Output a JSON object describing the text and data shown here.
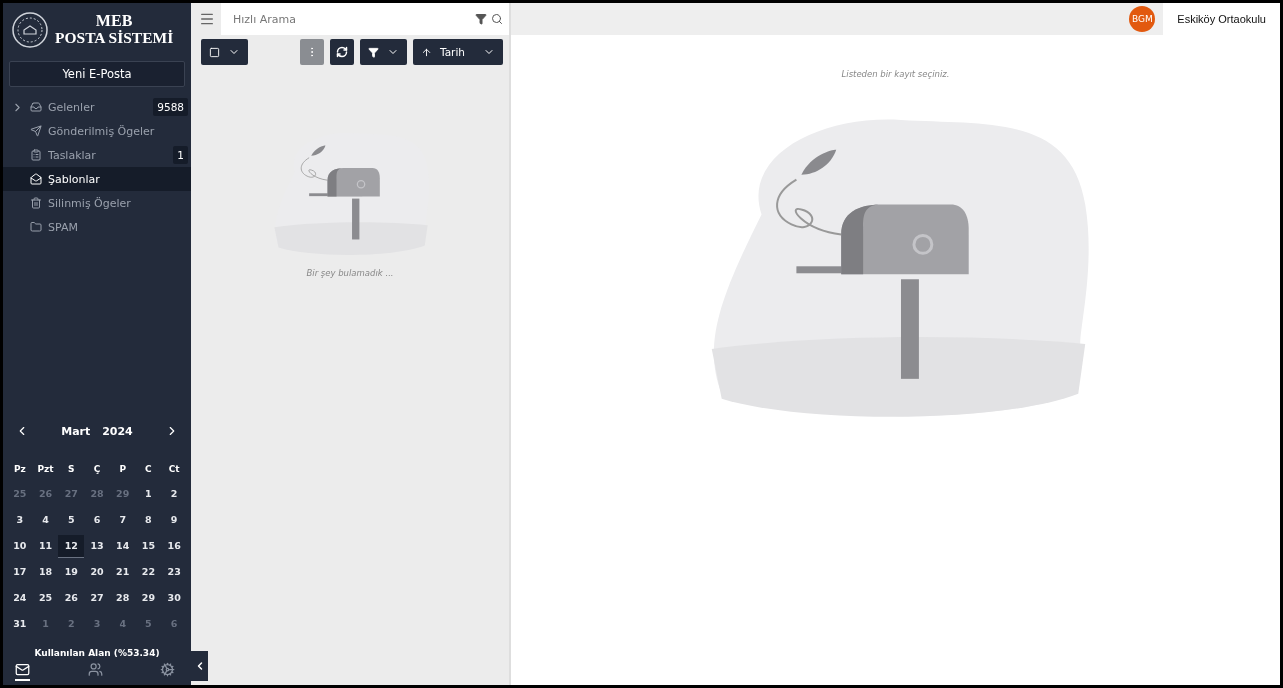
{
  "logo": {
    "line1": "MEB",
    "line2": "POSTA SİSTEMİ"
  },
  "new_mail_button": "Yeni E-Posta",
  "folders": [
    {
      "label": "Gelenler",
      "count": "9588",
      "expandable": true,
      "selected": false
    },
    {
      "label": "Gönderilmiş Ögeler",
      "expandable": false,
      "selected": false
    },
    {
      "label": "Taslaklar",
      "count": "1",
      "expandable": false,
      "selected": false
    },
    {
      "label": "Şablonlar",
      "expandable": false,
      "selected": true
    },
    {
      "label": "Silinmiş Ögeler",
      "expandable": false,
      "selected": false
    },
    {
      "label": "SPAM",
      "expandable": false,
      "selected": false
    }
  ],
  "calendar": {
    "month": "Mart",
    "year": "2024",
    "weekdays": [
      "Pz",
      "Pzt",
      "S",
      "Ç",
      "P",
      "C",
      "Ct"
    ],
    "weeks": [
      [
        {
          "day": "25",
          "muted": true,
          "selected": false
        },
        {
          "day": "26",
          "muted": true,
          "selected": false
        },
        {
          "day": "27",
          "muted": true,
          "selected": false
        },
        {
          "day": "28",
          "muted": true,
          "selected": false
        },
        {
          "day": "29",
          "muted": true,
          "selected": false
        },
        {
          "day": "1",
          "muted": false,
          "selected": false
        },
        {
          "day": "2",
          "muted": false,
          "selected": false
        }
      ],
      [
        {
          "day": "3",
          "muted": false,
          "selected": false
        },
        {
          "day": "4",
          "muted": false,
          "selected": false
        },
        {
          "day": "5",
          "muted": false,
          "selected": false
        },
        {
          "day": "6",
          "muted": false,
          "selected": false
        },
        {
          "day": "7",
          "muted": false,
          "selected": false
        },
        {
          "day": "8",
          "muted": false,
          "selected": false
        },
        {
          "day": "9",
          "muted": false,
          "selected": false
        }
      ],
      [
        {
          "day": "10",
          "muted": false,
          "selected": false
        },
        {
          "day": "11",
          "muted": false,
          "selected": false
        },
        {
          "day": "12",
          "muted": false,
          "selected": true
        },
        {
          "day": "13",
          "muted": false,
          "selected": false
        },
        {
          "day": "14",
          "muted": false,
          "selected": false
        },
        {
          "day": "15",
          "muted": false,
          "selected": false
        },
        {
          "day": "16",
          "muted": false,
          "selected": false
        }
      ],
      [
        {
          "day": "17",
          "muted": false,
          "selected": false
        },
        {
          "day": "18",
          "muted": false,
          "selected": false
        },
        {
          "day": "19",
          "muted": false,
          "selected": false
        },
        {
          "day": "20",
          "muted": false,
          "selected": false
        },
        {
          "day": "21",
          "muted": false,
          "selected": false
        },
        {
          "day": "22",
          "muted": false,
          "selected": false
        },
        {
          "day": "23",
          "muted": false,
          "selected": false
        }
      ],
      [
        {
          "day": "24",
          "muted": false,
          "selected": false
        },
        {
          "day": "25",
          "muted": false,
          "selected": false
        },
        {
          "day": "26",
          "muted": false,
          "selected": false
        },
        {
          "day": "27",
          "muted": false,
          "selected": false
        },
        {
          "day": "28",
          "muted": false,
          "selected": false
        },
        {
          "day": "29",
          "muted": false,
          "selected": false
        },
        {
          "day": "30",
          "muted": false,
          "selected": false
        }
      ],
      [
        {
          "day": "31",
          "muted": false,
          "selected": false
        },
        {
          "day": "1",
          "muted": true,
          "selected": false
        },
        {
          "day": "2",
          "muted": true,
          "selected": false
        },
        {
          "day": "3",
          "muted": true,
          "selected": false
        },
        {
          "day": "4",
          "muted": true,
          "selected": false
        },
        {
          "day": "5",
          "muted": true,
          "selected": false
        },
        {
          "day": "6",
          "muted": true,
          "selected": false
        }
      ]
    ]
  },
  "storage": "Kullanılan Alan (%53.34)",
  "bottom_nav": [
    {
      "selected": true
    },
    {
      "selected": false
    },
    {
      "selected": false
    }
  ],
  "search": {
    "placeholder": "Hızlı Arama"
  },
  "toolbar": {
    "sort_label": "Tarih"
  },
  "list": {
    "empty_message": "Bir şey bulamadık ..."
  },
  "preview": {
    "message": "Listeden bir kayıt seçiniz."
  },
  "user": {
    "initials": "BGM",
    "name": "Eskiköy Ortaokulu"
  }
}
